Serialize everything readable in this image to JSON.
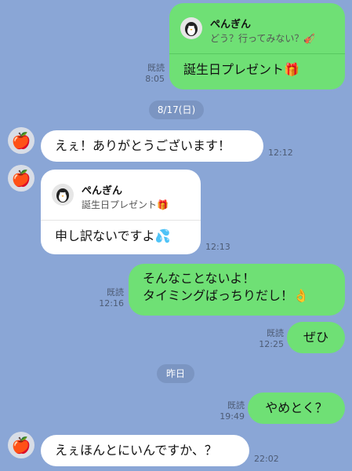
{
  "messages": {
    "m1": {
      "quote_name": "ぺんぎん",
      "quote_text": "どう？行ってみない？🎻",
      "text": "誕生日プレゼント🎁",
      "read_label": "既読",
      "time": "8:05"
    },
    "date1": "8/17(日)",
    "m2": {
      "text": "えぇ！ありがとうございます！",
      "time": "12:12"
    },
    "m3": {
      "quote_name": "ぺんぎん",
      "quote_text": "誕生日プレゼント🎁",
      "text": "申し訳ないですよ💦",
      "time": "12:13"
    },
    "m4": {
      "line1": "そんなことないよ！",
      "line2": "タイミングばっちりだし！👌",
      "read_label": "既読",
      "time": "12:16"
    },
    "m5": {
      "text": "ぜひ",
      "read_label": "既読",
      "time": "12:25"
    },
    "date2": "昨日",
    "m6": {
      "text": "やめとく？",
      "read_label": "既読",
      "time": "19:49"
    },
    "m7": {
      "text": "えぇほんとにいんですか、？",
      "time": "22:02"
    }
  },
  "colors": {
    "background": "#8aa6d6",
    "sent_bubble": "#6fe075",
    "received_bubble": "#ffffff"
  },
  "icons": {
    "avatar_self": "penguin-icon",
    "avatar_other": "apple-icon"
  }
}
